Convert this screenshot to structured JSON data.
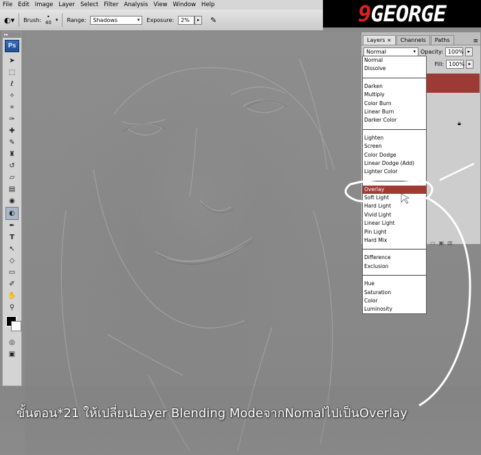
{
  "menu": [
    "File",
    "Edit",
    "Image",
    "Layer",
    "Select",
    "Filter",
    "Analysis",
    "View",
    "Window",
    "Help"
  ],
  "logo": {
    "accent": "9",
    "text": "GEORGE",
    "accent_color": "#e0201c"
  },
  "options": {
    "brush_label": "Brush:",
    "brush_size": "40",
    "range_label": "Range:",
    "range_value": "Shadows",
    "exposure_label": "Exposure:",
    "exposure_value": "2%"
  },
  "toolbox": {
    "app_badge": "Ps"
  },
  "layers_panel": {
    "tabs": [
      "Layers",
      "Channels",
      "Paths"
    ],
    "blend_mode": "Normal",
    "opacity_label": "Opacity:",
    "opacity_value": "100%",
    "fill_label": "Fill:",
    "fill_value": "100%",
    "layer_color": "#9c3a35"
  },
  "blend_modes": {
    "groups": [
      [
        "Normal",
        "Dissolve"
      ],
      [
        "Darken",
        "Multiply",
        "Color Burn",
        "Linear Burn",
        "Darker Color"
      ],
      [
        "Lighten",
        "Screen",
        "Color Dodge",
        "Linear Dodge (Add)",
        "Lighter Color"
      ],
      [
        "Overlay",
        "Soft Light",
        "Hard Light",
        "Vivid Light",
        "Linear Light",
        "Pin Light",
        "Hard Mix"
      ],
      [
        "Difference",
        "Exclusion"
      ],
      [
        "Hue",
        "Saturation",
        "Color",
        "Luminosity"
      ]
    ],
    "highlighted": "Overlay",
    "highlight_color": "#a23a33"
  },
  "caption": "ขั้นตอน*21 ให้เปลี่ยนLayer Blending ModeจากNomalไปเป็นOverlay"
}
